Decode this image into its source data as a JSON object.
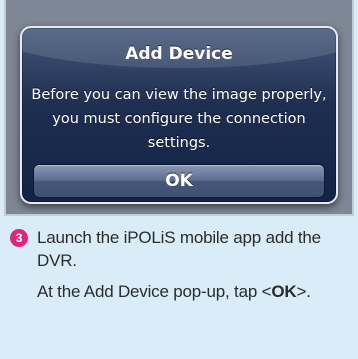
{
  "dialog": {
    "title": "Add Device",
    "message": "Before you can view the image properly, you must configure the connection settings.",
    "ok_label": "OK"
  },
  "step": {
    "number": "3",
    "line1": "Launch the iPOLiS mobile app add the DVR.",
    "line2_prefix": "At the Add Device pop-up, tap <",
    "line2_bold": "OK",
    "line2_suffix": ">."
  },
  "colors": {
    "background": "#d9ecf8",
    "step_badge": "#e0267a"
  }
}
